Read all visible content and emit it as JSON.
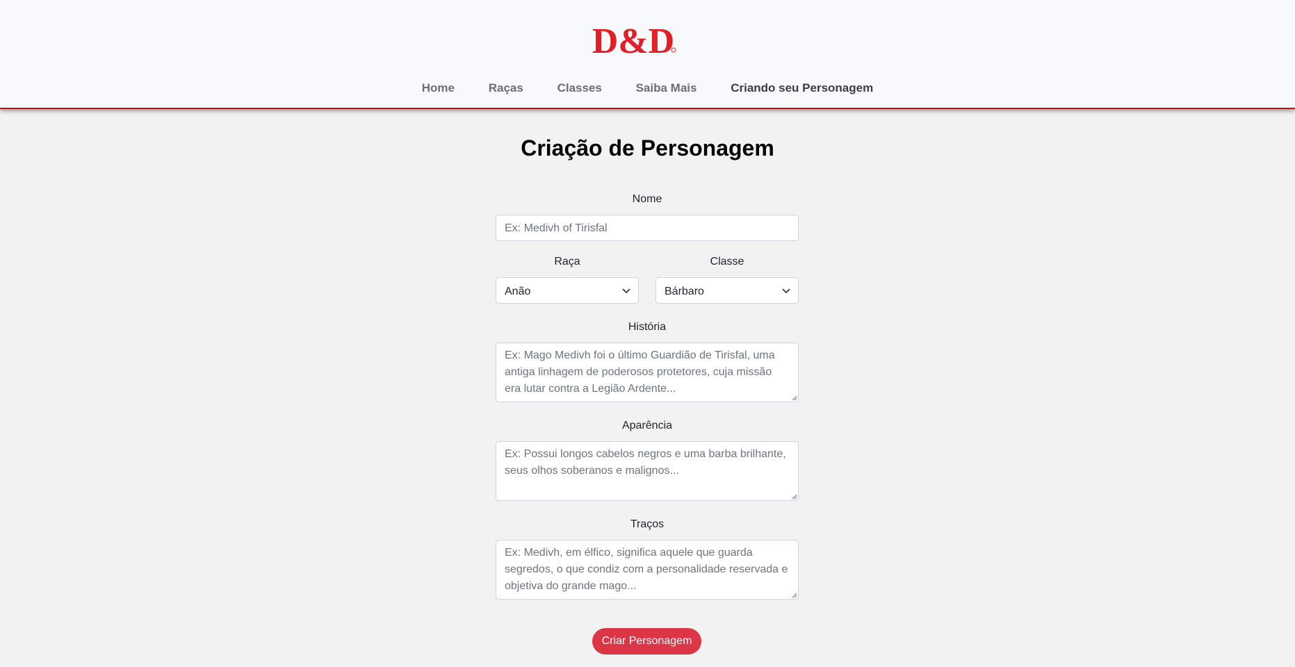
{
  "brand": {
    "logo_text": "D&D",
    "color": "#e21f26"
  },
  "nav": {
    "items": [
      {
        "label": "Home"
      },
      {
        "label": "Raças"
      },
      {
        "label": "Classes"
      },
      {
        "label": "Saiba Mais"
      },
      {
        "label": "Criando seu Personagem",
        "active": true
      }
    ]
  },
  "page": {
    "title": "Criação de Personagem"
  },
  "form": {
    "nome": {
      "label": "Nome",
      "placeholder": "Ex: Medivh of Tirisfal"
    },
    "raca": {
      "label": "Raça",
      "value": "Anão"
    },
    "classe": {
      "label": "Classe",
      "value": "Bárbaro"
    },
    "historia": {
      "label": "História",
      "placeholder": "Ex: Mago Medivh foi o último Guardião de Tirisfal, uma antiga linhagem de poderosos protetores, cuja missão era lutar contra a Legião Ardente..."
    },
    "aparencia": {
      "label": "Aparência",
      "placeholder": "Ex: Possui longos cabelos negros e uma barba brilhante, seus olhos soberanos e malignos..."
    },
    "tracos": {
      "label": "Traços",
      "placeholder": "Ex: Medivh, em élfico, significa aquele que guarda segredos, o que condiz com a personalidade reservada e objetiva do grande mago..."
    },
    "submit_label": "Criar Personagem"
  },
  "colors": {
    "accent": "#dc3545",
    "header_border": "#b31717"
  },
  "icons": [
    "dnd-logo",
    "chevron-down-icon",
    "resize-handle-icon"
  ]
}
